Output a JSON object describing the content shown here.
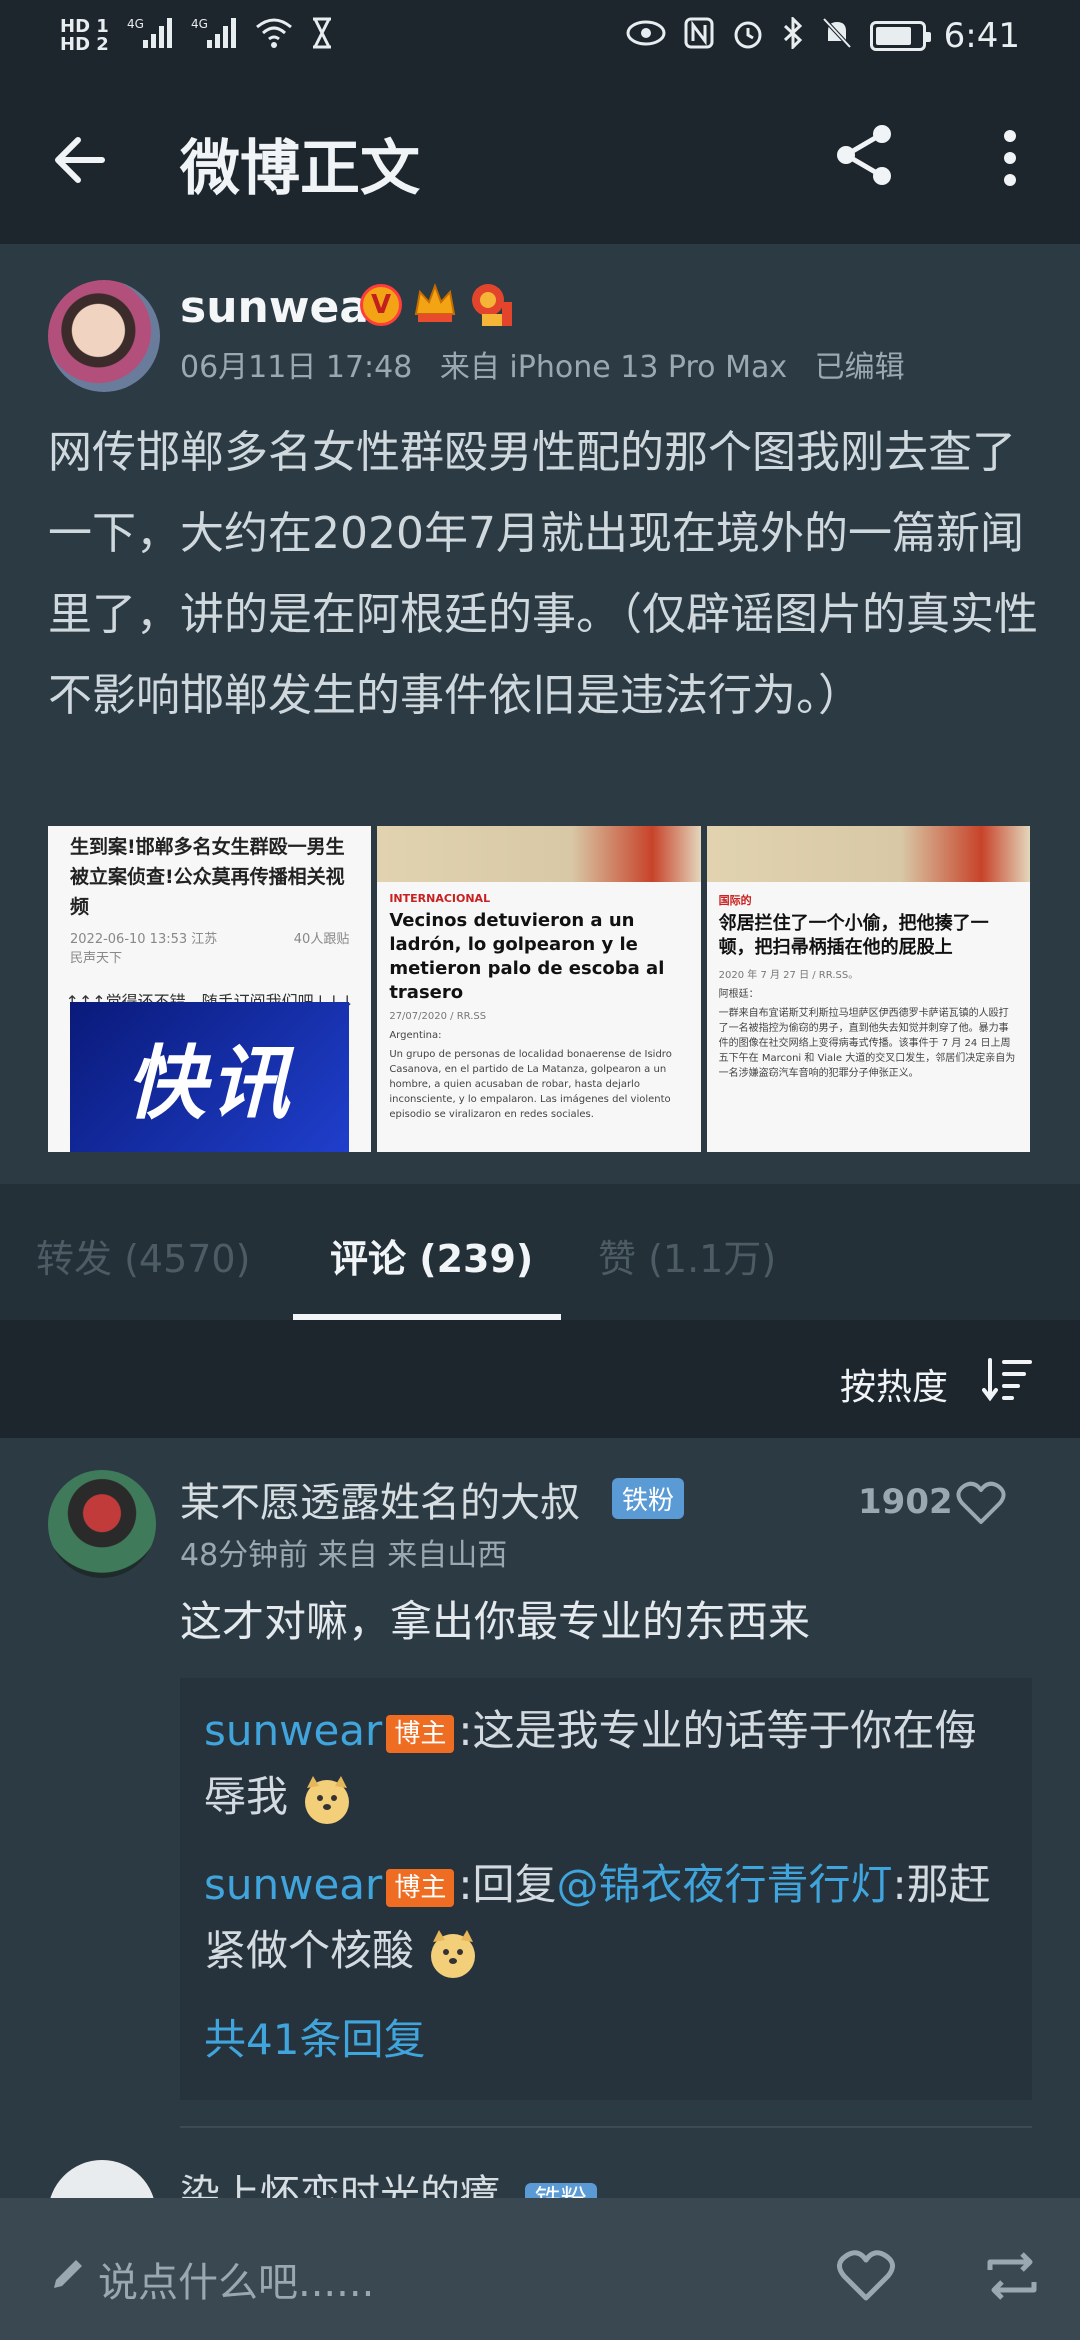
{
  "status_bar": {
    "sim1": "HD 1",
    "sim2": "HD 2",
    "network1": "4G",
    "network2": "4G",
    "time": "6:41"
  },
  "appbar": {
    "title": "微博正文"
  },
  "post": {
    "username": "sunwear",
    "verified_badge": "V",
    "date": "06月11日 17:48",
    "source": "来自 iPhone 13 Pro Max",
    "edited": "已编辑",
    "text": "网传邯郸多名女性群殴男性配的那个图我刚去查了一下，大约在2020年7月就出现在境外的一篇新闻里了，讲的是在阿根廷的事。（仅辟谣图片的真实性不影响邯郸发生的事件依旧是违法行为。）",
    "images": [
      {
        "headline": "生到案!邯郸多名女生群殴一男生被立案侦查!公众莫再传播相关视频",
        "date": "2022-06-10 13:53 江苏",
        "comments": "40人跟贴",
        "source": "民声天下",
        "sub": "↑↑↑觉得还不错，随手订阅我们吧↓↓↓",
        "banner": "快讯"
      },
      {
        "tag": "INTERNACIONAL",
        "headline": "Vecinos detuvieron a un ladrón, lo golpearon y le metieron palo de escoba al trasero",
        "date": "27/07/2020 / RR.SS",
        "location": "Argentina:",
        "body": "Un grupo de personas de localidad bonaerense de Isidro Casanova, en el partido de La Matanza, golpearon a un hombre, a quien acusaban de robar, hasta dejarlo inconsciente, y lo empalaron. Las imágenes del violento episodio se viralizaron en redes sociales."
      },
      {
        "tag": "国际的",
        "headline": "邻居拦住了一个小偷，把他揍了一顿，把扫帚柄插在他的屁股上",
        "date": "2020 年 7 月 27 日 / RR.SS。",
        "location": "阿根廷：",
        "body": "一群来自布宜诺斯艾利斯拉马坦萨区伊西德罗卡萨诺瓦镇的人殴打了一名被指控为偷窃的男子，直到他失去知觉并刺穿了他。暴力事件的图像在社交网络上变得病毒式传播。该事件于 7 月 24 日上周五下午在 Marconi 和 Viale 大道的交叉口发生，邻居们决定亲自为一名涉嫌盗窃汽车音响的犯罪分子伸张正义。"
      }
    ]
  },
  "tabs": [
    {
      "label": "转发 (4570)"
    },
    {
      "label": "评论 (239)"
    },
    {
      "label": "赞 (1.1万)"
    }
  ],
  "sort": {
    "label": "按热度"
  },
  "comments": [
    {
      "name": "某不愿透露姓名的大叔",
      "badge": "铁粉",
      "time": "48分钟前",
      "source": "来自 来自山西",
      "likes": "1902",
      "text": "这才对嘛，拿出你最专业的东西来",
      "replies": [
        {
          "name": "sunwear",
          "badge": "博主",
          "text": ":这是我专业的话等于你在侮辱我"
        },
        {
          "name": "sunwear",
          "badge": "博主",
          "prefix": ":回复",
          "mention": "@锦衣夜行青行灯",
          "text": ":那赶紧做个核酸"
        }
      ],
      "more_replies": "共41条回复"
    },
    {
      "name": "染上怀恋时光的癔",
      "badge": "铁粉"
    }
  ],
  "input": {
    "placeholder": "说点什么吧......"
  }
}
